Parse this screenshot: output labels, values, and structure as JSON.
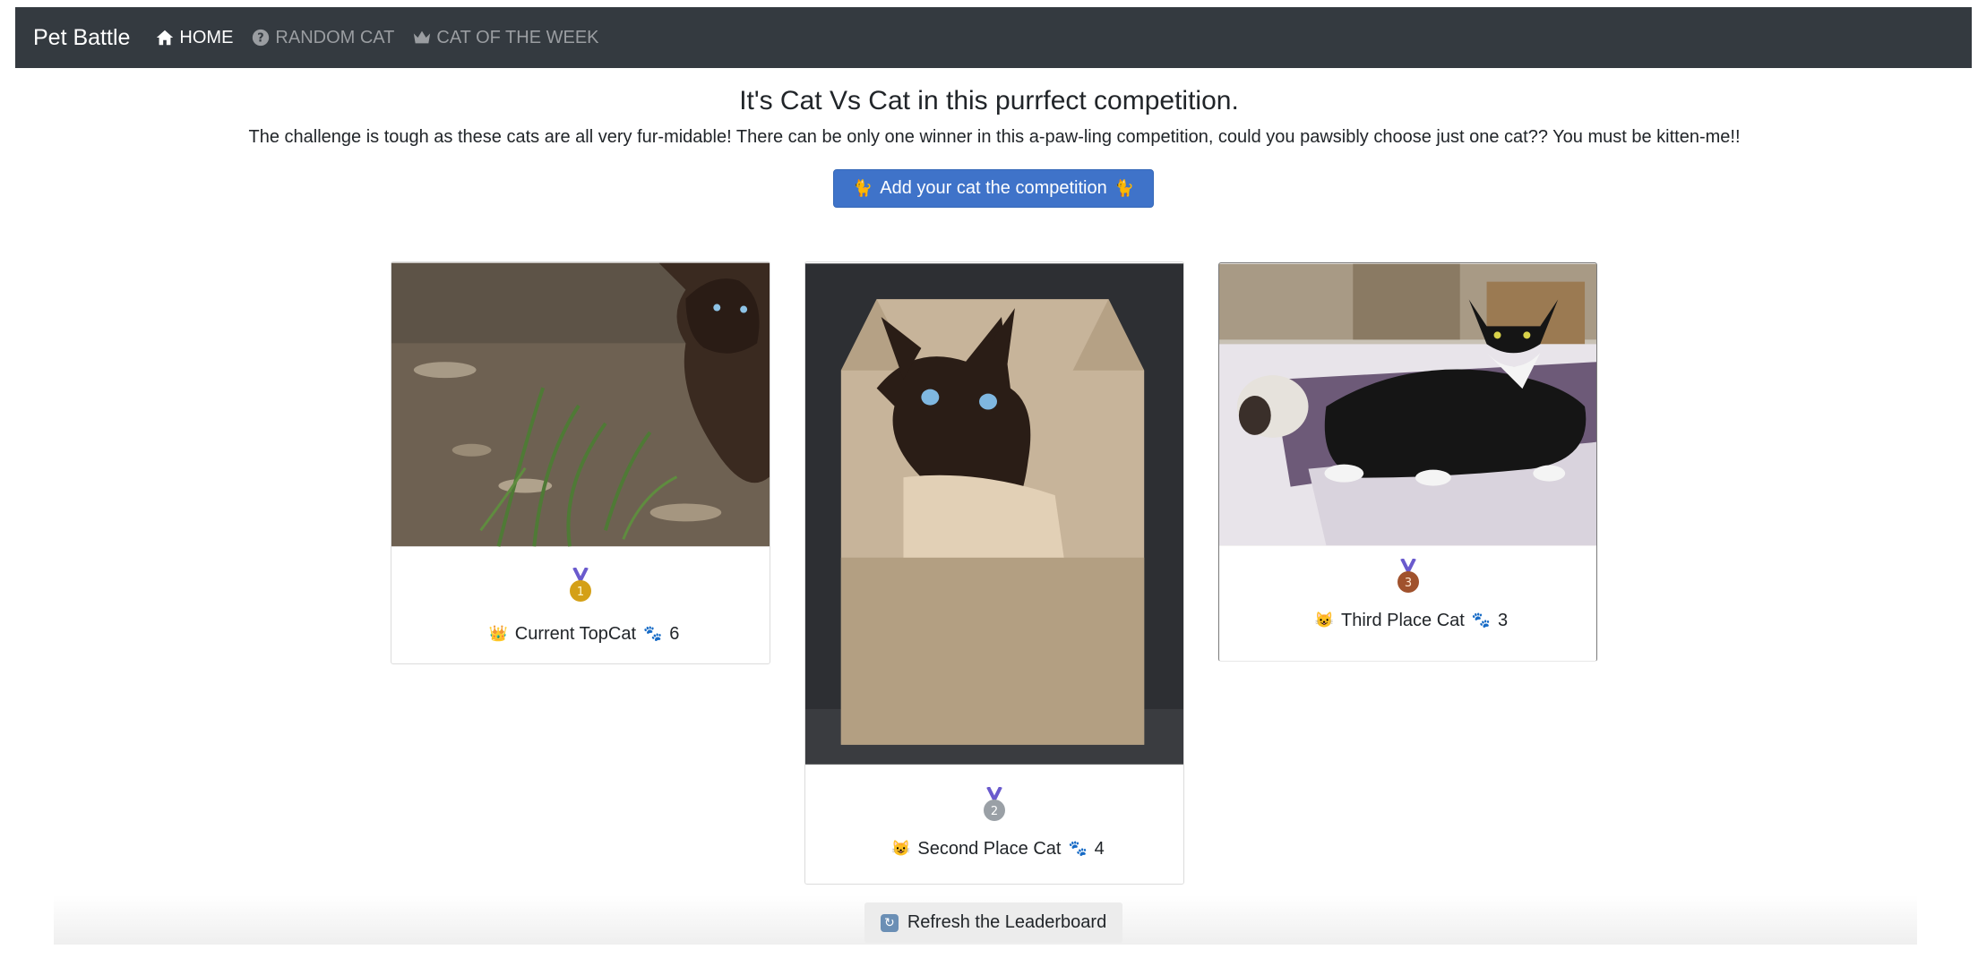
{
  "navbar": {
    "brand": "Pet Battle",
    "items": [
      {
        "label": "HOME",
        "icon": "home-icon",
        "active": true
      },
      {
        "label": "RANDOM CAT",
        "icon": "question-circle-icon",
        "active": false
      },
      {
        "label": "CAT OF THE WEEK",
        "icon": "crown-icon",
        "active": false
      }
    ]
  },
  "hero": {
    "title": "It's Cat Vs Cat in this purrfect competition.",
    "lead": "The challenge is tough as these cats are all very fur-midable! There can be only one winner in this a-paw-ling competition, could you pawsibly choose just one cat?? You must be kitten-me!!",
    "add_button_label": "Add your cat the competition"
  },
  "leaderboard": [
    {
      "rank": "1",
      "medal_icon": "gold-medal-icon",
      "label_icon": "crown-icon",
      "label": "Current TopCat",
      "votes_icon": "paw-icon",
      "votes": "6",
      "medal_color": "#d4a017"
    },
    {
      "rank": "2",
      "medal_icon": "silver-medal-icon",
      "label_icon": "cat-face-icon",
      "label": "Second Place Cat",
      "votes_icon": "paw-icon",
      "votes": "4",
      "medal_color": "#9aa0a6"
    },
    {
      "rank": "3",
      "medal_icon": "bronze-medal-icon",
      "label_icon": "cat-face-icon",
      "label": "Third Place Cat",
      "votes_icon": "paw-icon",
      "votes": "3",
      "medal_color": "#a0522d"
    }
  ],
  "refresh_button_label": "Refresh the Leaderboard",
  "colors": {
    "navbar": "#343a40",
    "primary": "#3f73c9"
  }
}
